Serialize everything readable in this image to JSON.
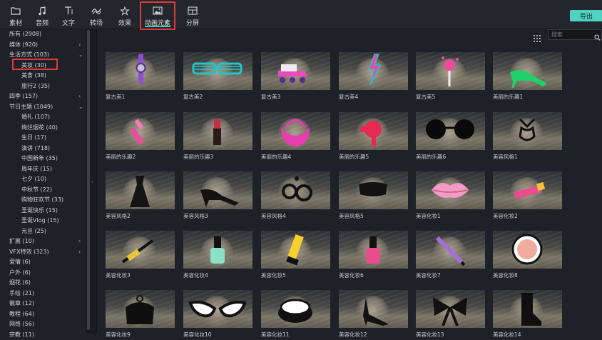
{
  "toolbar": {
    "tabs": [
      {
        "label": "素材",
        "icon": "folder-icon"
      },
      {
        "label": "音频",
        "icon": "music-note-icon"
      },
      {
        "label": "文字",
        "icon": "text-icon"
      },
      {
        "label": "转场",
        "icon": "transition-icon"
      },
      {
        "label": "效果",
        "icon": "effects-icon"
      },
      {
        "label": "动画元素",
        "icon": "image-icon"
      },
      {
        "label": "分屏",
        "icon": "split-screen-icon"
      }
    ],
    "active_tab": "动画元素",
    "export_label": "导出",
    "accent_color": "#4fd1c3",
    "highlight_color": "#e03a3a"
  },
  "sidebar": {
    "items": [
      {
        "label": "所有 (2908)",
        "chevron": ""
      },
      {
        "label": "媒体 (920)",
        "chevron": "›"
      },
      {
        "label": "生活方式 (103)",
        "chevron": "⌄"
      },
      {
        "label": "美妆 (30)",
        "chevron": ""
      },
      {
        "label": "美食 (38)",
        "chevron": ""
      },
      {
        "label": "旅行2 (35)",
        "chevron": ""
      },
      {
        "label": "四季 (157)",
        "chevron": "›"
      },
      {
        "label": "节日主题 (1049)",
        "chevron": "⌄"
      },
      {
        "label": "婚礼 (107)",
        "chevron": ""
      },
      {
        "label": "绚烂烟花 (40)",
        "chevron": ""
      },
      {
        "label": "生日 (17)",
        "chevron": ""
      },
      {
        "label": "演讲 (718)",
        "chevron": ""
      },
      {
        "label": "中国新年 (35)",
        "chevron": ""
      },
      {
        "label": "周年庆 (15)",
        "chevron": ""
      },
      {
        "label": "七夕 (10)",
        "chevron": ""
      },
      {
        "label": "中秋节 (22)",
        "chevron": ""
      },
      {
        "label": "购物狂欢节 (33)",
        "chevron": ""
      },
      {
        "label": "圣诞快乐 (15)",
        "chevron": ""
      },
      {
        "label": "圣诞Vlog (15)",
        "chevron": ""
      },
      {
        "label": "元旦 (25)",
        "chevron": ""
      },
      {
        "label": "扩展 (10)",
        "chevron": "›"
      },
      {
        "label": "VFX特效 (323)",
        "chevron": "›"
      },
      {
        "label": "爱情 (6)",
        "chevron": ""
      },
      {
        "label": "户外 (6)",
        "chevron": ""
      },
      {
        "label": "烟花 (6)",
        "chevron": ""
      },
      {
        "label": "手绘 (21)",
        "chevron": ""
      },
      {
        "label": "徽章 (12)",
        "chevron": ""
      },
      {
        "label": "教程 (64)",
        "chevron": ""
      },
      {
        "label": "网络 (56)",
        "chevron": ""
      },
      {
        "label": "宗教 (11)",
        "chevron": ""
      }
    ],
    "selected": "美妆 (30)"
  },
  "search": {
    "placeholder": "搜索",
    "value": ""
  },
  "grid": {
    "items": [
      {
        "label": "复古美1",
        "icon": "purple-watch-icon"
      },
      {
        "label": "复古美2",
        "icon": "teal-shutter-glasses-icon"
      },
      {
        "label": "复古美3",
        "icon": "roller-skate-icon"
      },
      {
        "label": "复古美4",
        "icon": "lightning-bolt-icon"
      },
      {
        "label": "复古美5",
        "icon": "lollipop-icon"
      },
      {
        "label": "美丽的乐趣1",
        "icon": "green-high-heel-icon"
      },
      {
        "label": "美丽的乐趣2",
        "icon": "pink-lipstick-icon"
      },
      {
        "label": "美丽的乐趣3",
        "icon": "lipstick-tube-icon"
      },
      {
        "label": "美丽的乐趣4",
        "icon": "pink-handbag-icon"
      },
      {
        "label": "美丽的乐趣5",
        "icon": "hair-dryer-icon"
      },
      {
        "label": "美丽的乐趣6",
        "icon": "round-sunglasses-icon"
      },
      {
        "label": "美容风格1",
        "icon": "bikini-icon"
      },
      {
        "label": "美容风格2",
        "icon": "black-dress-icon"
      },
      {
        "label": "美容风格3",
        "icon": "black-heel-icon"
      },
      {
        "label": "美容风格4",
        "icon": "earrings-icon"
      },
      {
        "label": "美容风格5",
        "icon": "clutch-bag-icon"
      },
      {
        "label": "美容化妆1",
        "icon": "pink-lips-icon"
      },
      {
        "label": "美容化妆2",
        "icon": "lipstick-icon"
      },
      {
        "label": "美容化妆3",
        "icon": "mascara-brush-icon"
      },
      {
        "label": "美容化妆4",
        "icon": "nail-polish-teal-icon"
      },
      {
        "label": "美容化妆5",
        "icon": "yellow-tube-icon"
      },
      {
        "label": "美容化妆6",
        "icon": "nail-polish-pink-icon"
      },
      {
        "label": "美容化妆7",
        "icon": "purple-pencil-icon"
      },
      {
        "label": "美容化妆8",
        "icon": "compact-blush-icon"
      },
      {
        "label": "美容化妆9",
        "icon": "coin-purse-icon"
      },
      {
        "label": "美容化妆10",
        "icon": "cat-eye-glasses-icon"
      },
      {
        "label": "美容化妆11",
        "icon": "compact-mirror-icon"
      },
      {
        "label": "美容化妆12",
        "icon": "stiletto-icon"
      },
      {
        "label": "美容化妆13",
        "icon": "bow-icon"
      },
      {
        "label": "美容化妆14",
        "icon": "ankle-boot-icon"
      }
    ]
  }
}
